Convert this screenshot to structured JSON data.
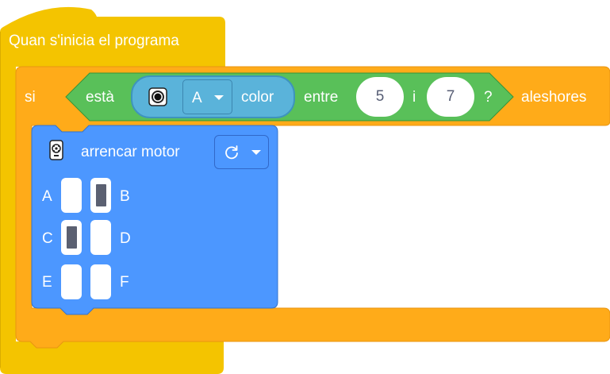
{
  "hat_block": {
    "label": "Quan s'inicia el programa",
    "color": "#f4c400"
  },
  "if_block": {
    "if_label": "si",
    "then_label": "aleshores",
    "color": "#ffab19"
  },
  "condition": {
    "prefix": "està",
    "sensor_icon": "color-sensor-icon",
    "port_value": "A",
    "property": "color",
    "between_label": "entre",
    "min_value": "5",
    "and_label": "i",
    "max_value": "7",
    "question": "?",
    "color": "#59c059",
    "sensor_color": "#5ab3da"
  },
  "motor_block": {
    "icon": "motor-icon",
    "label": "arrencar motor",
    "direction_icon": "clockwise-arrow-icon",
    "color": "#4c97ff",
    "ports": [
      {
        "label": "A",
        "selected": false
      },
      {
        "label": "B",
        "selected": true
      },
      {
        "label": "C",
        "selected": true
      },
      {
        "label": "D",
        "selected": false
      },
      {
        "label": "E",
        "selected": false
      },
      {
        "label": "F",
        "selected": false
      }
    ]
  }
}
